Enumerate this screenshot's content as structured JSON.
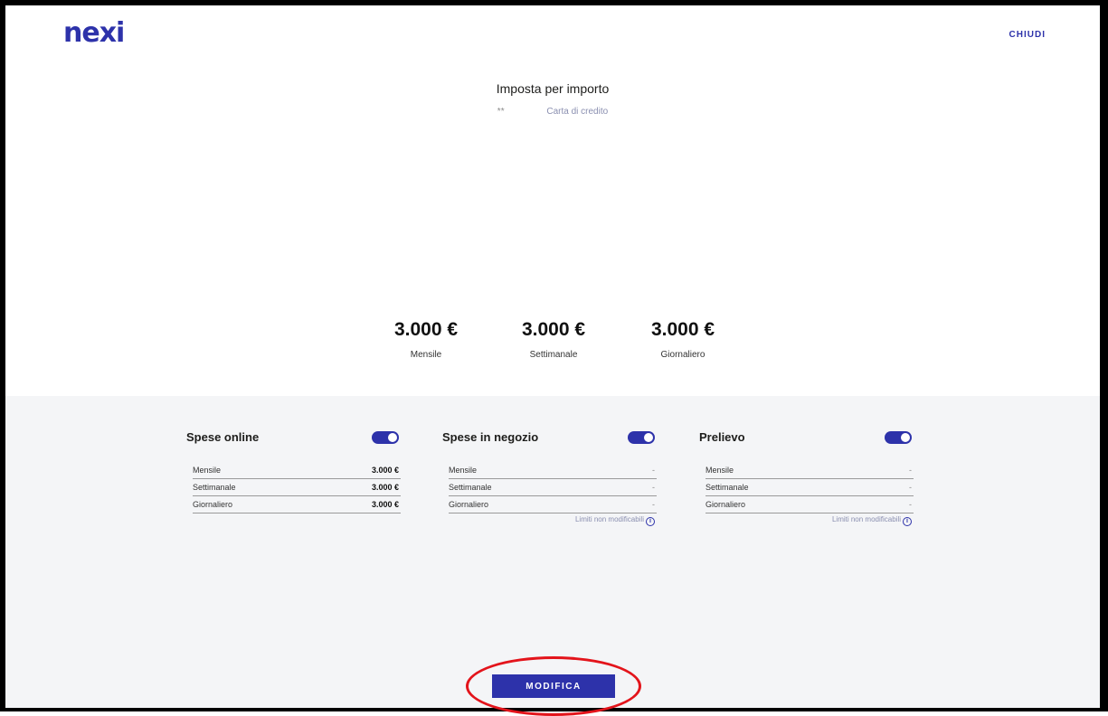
{
  "header": {
    "logo_text": "nexi",
    "close_label": "CHIUDI"
  },
  "main": {
    "title": "Imposta per importo",
    "card_mask": "**",
    "card_type": "Carta di credito",
    "totals": [
      {
        "amount": "3.000 €",
        "label": "Mensile"
      },
      {
        "amount": "3.000 €",
        "label": "Settimanale"
      },
      {
        "amount": "3.000 €",
        "label": "Giornaliero"
      }
    ]
  },
  "sections": [
    {
      "title": "Spese online",
      "toggle_on": true,
      "rows": [
        {
          "key": "Mensile",
          "value": "3.000 €"
        },
        {
          "key": "Settimanale",
          "value": "3.000 €"
        },
        {
          "key": "Giornaliero",
          "value": "3.000 €"
        }
      ],
      "note": ""
    },
    {
      "title": "Spese in negozio",
      "toggle_on": true,
      "rows": [
        {
          "key": "Mensile",
          "value": "-"
        },
        {
          "key": "Settimanale",
          "value": "-"
        },
        {
          "key": "Giornaliero",
          "value": "-"
        }
      ],
      "note": "Limiti non modificabili"
    },
    {
      "title": "Prelievo",
      "toggle_on": true,
      "rows": [
        {
          "key": "Mensile",
          "value": "-"
        },
        {
          "key": "Settimanale",
          "value": "-"
        },
        {
          "key": "Giornaliero",
          "value": "-"
        }
      ],
      "note": "Limiti non modificabili"
    }
  ],
  "footer": {
    "edit_label": "MODIFICA"
  },
  "colors": {
    "brand": "#2d32aa",
    "panel_bg": "#f4f5f7",
    "highlight": "#e3141b"
  },
  "icons": {
    "info": "info-icon"
  }
}
